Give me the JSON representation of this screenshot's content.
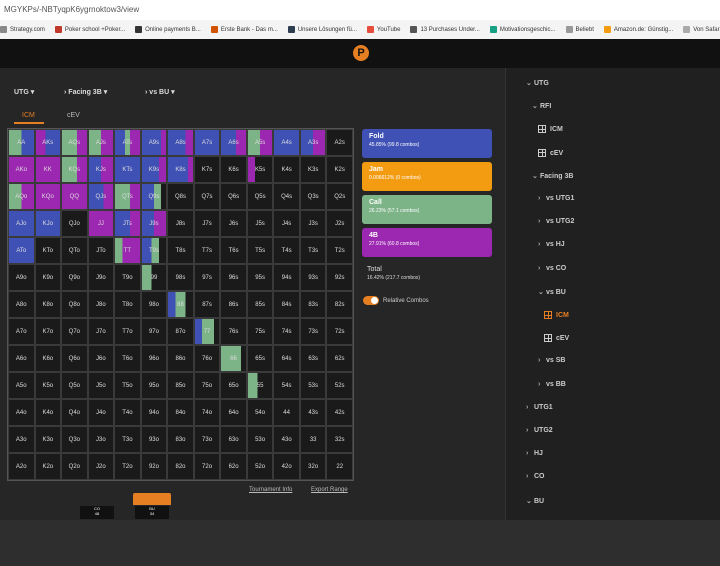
{
  "browser": {
    "url": "MGYKPs/-NBTyqpK6ygrnoktow3/view",
    "bookmarks": [
      "Strategy.com",
      "Poker school +Poker...",
      "Online payments B...",
      "Erste Bank - Das m...",
      "Unsere Lösungen fü...",
      "YouTube",
      "13 Purchases Under...",
      "Motivationsgeschic...",
      "Beliebt",
      "Amazon.de: Günstig...",
      "Von Safari importiert",
      "aMembe"
    ]
  },
  "app": {
    "logo": "P"
  },
  "filters": {
    "position": "UTG",
    "action": "Facing 3B",
    "opponent": "vs BU"
  },
  "tabs": {
    "icm": "ICM",
    "cev": "cEV"
  },
  "colors": {
    "fold": "#3f51b5",
    "jam": "#f39c12",
    "call": "#7cb387",
    "fourbet": "#9c27b0",
    "accent": "#e67e22"
  },
  "legend": [
    {
      "name": "Fold",
      "value": "45.85% (99.8 combos)"
    },
    {
      "name": "Jam",
      "value": "0.006612% (0 combos)"
    },
    {
      "name": "Call",
      "value": "26.23% (57.1 combos)"
    },
    {
      "name": "4B",
      "value": "27.91% (60.8 combos)"
    }
  ],
  "total": {
    "label": "Total",
    "value": "16.42% (217.7 combos)"
  },
  "relative_combos_label": "Relative Combos",
  "links": {
    "info": "Tournament Info",
    "export": "Export Range"
  },
  "grid": [
    [
      "AA",
      "AKs",
      "AQs",
      "AJs",
      "ATs",
      "A9s",
      "A8s",
      "A7s",
      "A6s",
      "A5s",
      "A4s",
      "A3s",
      "A2s"
    ],
    [
      "AKo",
      "KK",
      "KQs",
      "KJs",
      "KTs",
      "K9s",
      "K8s",
      "K7s",
      "K6s",
      "K5s",
      "K4s",
      "K3s",
      "K2s"
    ],
    [
      "AQo",
      "KQo",
      "QQ",
      "QJs",
      "QTs",
      "Q9s",
      "Q8s",
      "Q7s",
      "Q6s",
      "Q5s",
      "Q4s",
      "Q3s",
      "Q2s"
    ],
    [
      "AJo",
      "KJo",
      "QJo",
      "JJ",
      "JTs",
      "J9s",
      "J8s",
      "J7s",
      "J6s",
      "J5s",
      "J4s",
      "J3s",
      "J2s"
    ],
    [
      "ATo",
      "KTo",
      "QTo",
      "JTo",
      "TT",
      "T9s",
      "T8s",
      "T7s",
      "T6s",
      "T5s",
      "T4s",
      "T3s",
      "T2s"
    ],
    [
      "A9o",
      "K9o",
      "Q9o",
      "J9o",
      "T9o",
      "99",
      "98s",
      "97s",
      "96s",
      "95s",
      "94s",
      "93s",
      "92s"
    ],
    [
      "A8o",
      "K8o",
      "Q8o",
      "J8o",
      "T8o",
      "98o",
      "88",
      "87s",
      "86s",
      "85s",
      "84s",
      "83s",
      "82s"
    ],
    [
      "A7o",
      "K7o",
      "Q7o",
      "J7o",
      "T7o",
      "97o",
      "87o",
      "77",
      "76s",
      "75s",
      "74s",
      "73s",
      "72s"
    ],
    [
      "A6o",
      "K6o",
      "Q6o",
      "J6o",
      "T6o",
      "96o",
      "86o",
      "76o",
      "66",
      "65s",
      "64s",
      "63s",
      "62s"
    ],
    [
      "A5o",
      "K5o",
      "Q5o",
      "J5o",
      "T5o",
      "95o",
      "85o",
      "75o",
      "65o",
      "55",
      "54s",
      "53s",
      "52s"
    ],
    [
      "A4o",
      "K4o",
      "Q4o",
      "J4o",
      "T4o",
      "94o",
      "84o",
      "74o",
      "64o",
      "54o",
      "44",
      "43s",
      "42s"
    ],
    [
      "A3o",
      "K3o",
      "Q3o",
      "J3o",
      "T3o",
      "93o",
      "83o",
      "73o",
      "63o",
      "53o",
      "43o",
      "33",
      "32s"
    ],
    [
      "A2o",
      "K2o",
      "Q2o",
      "J2o",
      "T2o",
      "92o",
      "82o",
      "72o",
      "62o",
      "52o",
      "42o",
      "32o",
      "22"
    ]
  ],
  "cell_actions": {
    "AA": [
      [
        "call",
        50
      ],
      [
        "fold",
        50
      ]
    ],
    "AKs": [
      [
        "fourbet",
        40
      ],
      [
        "fold",
        60
      ]
    ],
    "AQs": [
      [
        "call",
        60
      ],
      [
        "fourbet",
        40
      ]
    ],
    "AJs": [
      [
        "call",
        50
      ],
      [
        "fourbet",
        50
      ]
    ],
    "ATs": [
      [
        "fold",
        40
      ],
      [
        "call",
        20
      ],
      [
        "fourbet",
        40
      ]
    ],
    "A9s": [
      [
        "fold",
        80
      ],
      [
        "fourbet",
        20
      ]
    ],
    "A8s": [
      [
        "fold",
        70
      ],
      [
        "fourbet",
        30
      ]
    ],
    "A7s": [
      [
        "fold",
        100
      ]
    ],
    "A6s": [
      [
        "fold",
        60
      ],
      [
        "fourbet",
        40
      ]
    ],
    "A5s": [
      [
        "call",
        50
      ],
      [
        "fourbet",
        50
      ]
    ],
    "A4s": [
      [
        "fold",
        100
      ]
    ],
    "A3s": [
      [
        "fold",
        50
      ],
      [
        "fourbet",
        50
      ]
    ],
    "AKo": [
      [
        "fourbet",
        100
      ]
    ],
    "KK": [
      [
        "fourbet",
        100
      ]
    ],
    "KQs": [
      [
        "call",
        60
      ],
      [
        "fourbet",
        40
      ]
    ],
    "KJs": [
      [
        "fold",
        50
      ],
      [
        "fourbet",
        50
      ]
    ],
    "KTs": [
      [
        "fold",
        100
      ]
    ],
    "K9s": [
      [
        "fold",
        70
      ],
      [
        "fourbet",
        30
      ]
    ],
    "K8s": [
      [
        "fold",
        80
      ],
      [
        "fourbet",
        20
      ]
    ],
    "K5s": [
      [
        "fourbet",
        30
      ]
    ],
    "AQo": [
      [
        "call",
        50
      ],
      [
        "fourbet",
        50
      ]
    ],
    "KQo": [
      [
        "fourbet",
        100
      ]
    ],
    "QQ": [
      [
        "fourbet",
        100
      ]
    ],
    "QJs": [
      [
        "fold",
        60
      ],
      [
        "fourbet",
        40
      ]
    ],
    "QTs": [
      [
        "call",
        60
      ],
      [
        "fourbet",
        40
      ]
    ],
    "Q9s": [
      [
        "fold",
        50
      ],
      [
        "call",
        30
      ]
    ],
    "AJo": [
      [
        "fold",
        100
      ]
    ],
    "KJo": [
      [
        "fold",
        100
      ]
    ],
    "JJ": [
      [
        "fourbet",
        100
      ]
    ],
    "JTs": [
      [
        "fold",
        60
      ],
      [
        "fourbet",
        40
      ]
    ],
    "J9s": [
      [
        "fold",
        50
      ],
      [
        "fourbet",
        50
      ]
    ],
    "ATo": [
      [
        "fold",
        100
      ]
    ],
    "TT": [
      [
        "call",
        30
      ],
      [
        "fourbet",
        70
      ]
    ],
    "T9s": [
      [
        "fold",
        40
      ],
      [
        "call",
        30
      ]
    ],
    "99": [
      [
        "call",
        40
      ]
    ],
    "88": [
      [
        "fold",
        30
      ],
      [
        "call",
        40
      ]
    ],
    "77": [
      [
        "fold",
        30
      ],
      [
        "call",
        50
      ]
    ],
    "66": [
      [
        "call",
        80
      ]
    ],
    "55": [
      [
        "call",
        40
      ]
    ]
  },
  "sidebar": {
    "items": [
      {
        "label": "UTG",
        "chev": "v",
        "icon": "",
        "level": 1,
        "active": false
      },
      {
        "label": "RFI",
        "chev": "v",
        "icon": "",
        "level": 2,
        "active": false
      },
      {
        "label": "ICM",
        "chev": "",
        "icon": "grid",
        "level": 3,
        "active": false
      },
      {
        "label": "cEV",
        "chev": "",
        "icon": "grid",
        "level": 3,
        "active": false
      },
      {
        "label": "Facing 3B",
        "chev": "v",
        "icon": "",
        "level": 2,
        "active": false
      },
      {
        "label": "vs UTG1",
        "chev": ">",
        "icon": "",
        "level": 3,
        "active": false
      },
      {
        "label": "vs UTG2",
        "chev": ">",
        "icon": "",
        "level": 3,
        "active": false
      },
      {
        "label": "vs HJ",
        "chev": ">",
        "icon": "",
        "level": 3,
        "active": false
      },
      {
        "label": "vs CO",
        "chev": ">",
        "icon": "",
        "level": 3,
        "active": false
      },
      {
        "label": "vs BU",
        "chev": "v",
        "icon": "",
        "level": 3,
        "active": false
      },
      {
        "label": "ICM",
        "chev": "",
        "icon": "grid",
        "level": 4,
        "active": true
      },
      {
        "label": "cEV",
        "chev": "",
        "icon": "grid",
        "level": 4,
        "active": false
      },
      {
        "label": "vs SB",
        "chev": ">",
        "icon": "",
        "level": 3,
        "active": false
      },
      {
        "label": "vs BB",
        "chev": ">",
        "icon": "",
        "level": 3,
        "active": false
      },
      {
        "label": "UTG1",
        "chev": ">",
        "icon": "",
        "level": 1,
        "active": false
      },
      {
        "label": "UTG2",
        "chev": ">",
        "icon": "",
        "level": 1,
        "active": false
      },
      {
        "label": "HJ",
        "chev": ">",
        "icon": "",
        "level": 1,
        "active": false
      },
      {
        "label": "CO",
        "chev": ">",
        "icon": "",
        "level": 1,
        "active": false
      },
      {
        "label": "BU",
        "chev": "v",
        "icon": "",
        "level": 1,
        "active": false
      }
    ]
  },
  "mini_seats": [
    {
      "label": "CO",
      "sub": "48"
    },
    {
      "label": "BU",
      "sub": "34"
    }
  ]
}
